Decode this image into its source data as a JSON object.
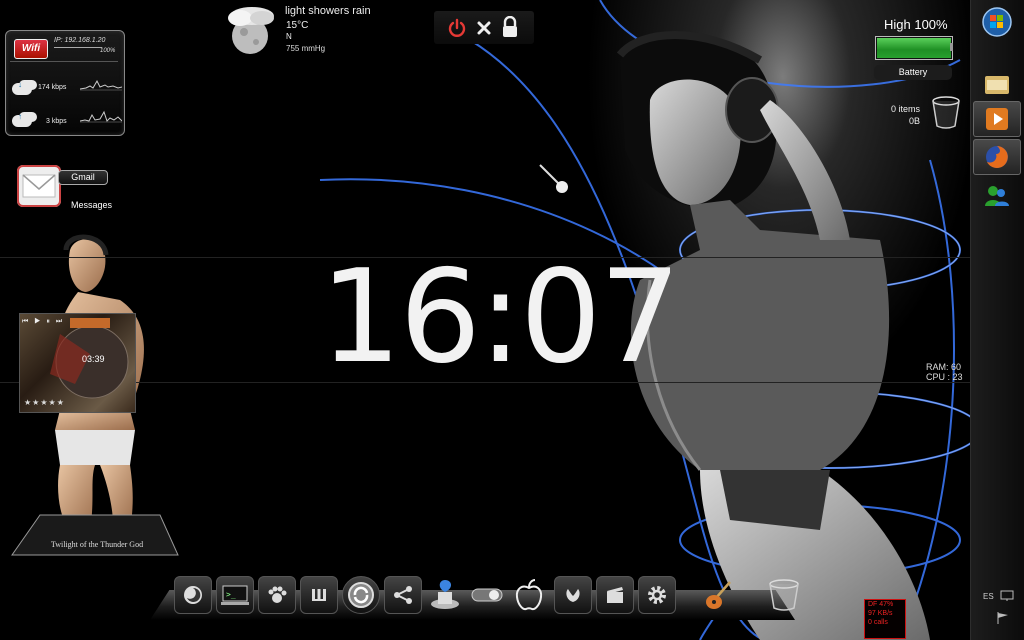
{
  "wifi": {
    "logo": "Wifi",
    "ip": "IP: 192.168.1.20",
    "signal": "100%",
    "download_speed": "174 kbps",
    "upload_speed": "3 kbps"
  },
  "weather": {
    "condition": "light showers rain",
    "temperature": "15°C",
    "wind_direction": "N",
    "pressure": "755 mmHg",
    "icon": "cloud-moon-icon"
  },
  "power_bar": {
    "buttons": [
      "power-icon",
      "close-icon",
      "lock-icon"
    ],
    "power_color": "#e53935"
  },
  "battery": {
    "title": "High 100%",
    "level": 1.0,
    "label": "Battery",
    "fill_color": "#2fa52f"
  },
  "recycle_bin": {
    "items": "0 items",
    "size": "0B"
  },
  "gmail": {
    "button": "Gmail",
    "messages": "Messages"
  },
  "clock": {
    "time": "16:07"
  },
  "system": {
    "ram": "RAM:  60",
    "cpu": "CPU :  23"
  },
  "player": {
    "controls": "⏮ ▶ ⏸ ⏭",
    "time": "03:39",
    "rating": "★★★★★",
    "track_title": "Twilight of the Thunder God"
  },
  "dock": {
    "items": [
      "firefox-icon",
      "terminal-icon",
      "paw-icon",
      "wiki-icon",
      "refresh-icon",
      "share-icon",
      "finder-icon",
      "switch-icon",
      "apple-icon",
      "flower-icon",
      "clapper-icon",
      "gear-icon",
      "guitar-icon",
      "trash-icon"
    ]
  },
  "sidebar": {
    "items": [
      "windows-start-icon",
      "folder-icon",
      "media-player-icon",
      "firefox-icon",
      "messenger-icon"
    ],
    "language": "ES"
  },
  "meter": {
    "lines": [
      "DF 47%",
      "97 KB/s",
      "0 calls"
    ]
  }
}
